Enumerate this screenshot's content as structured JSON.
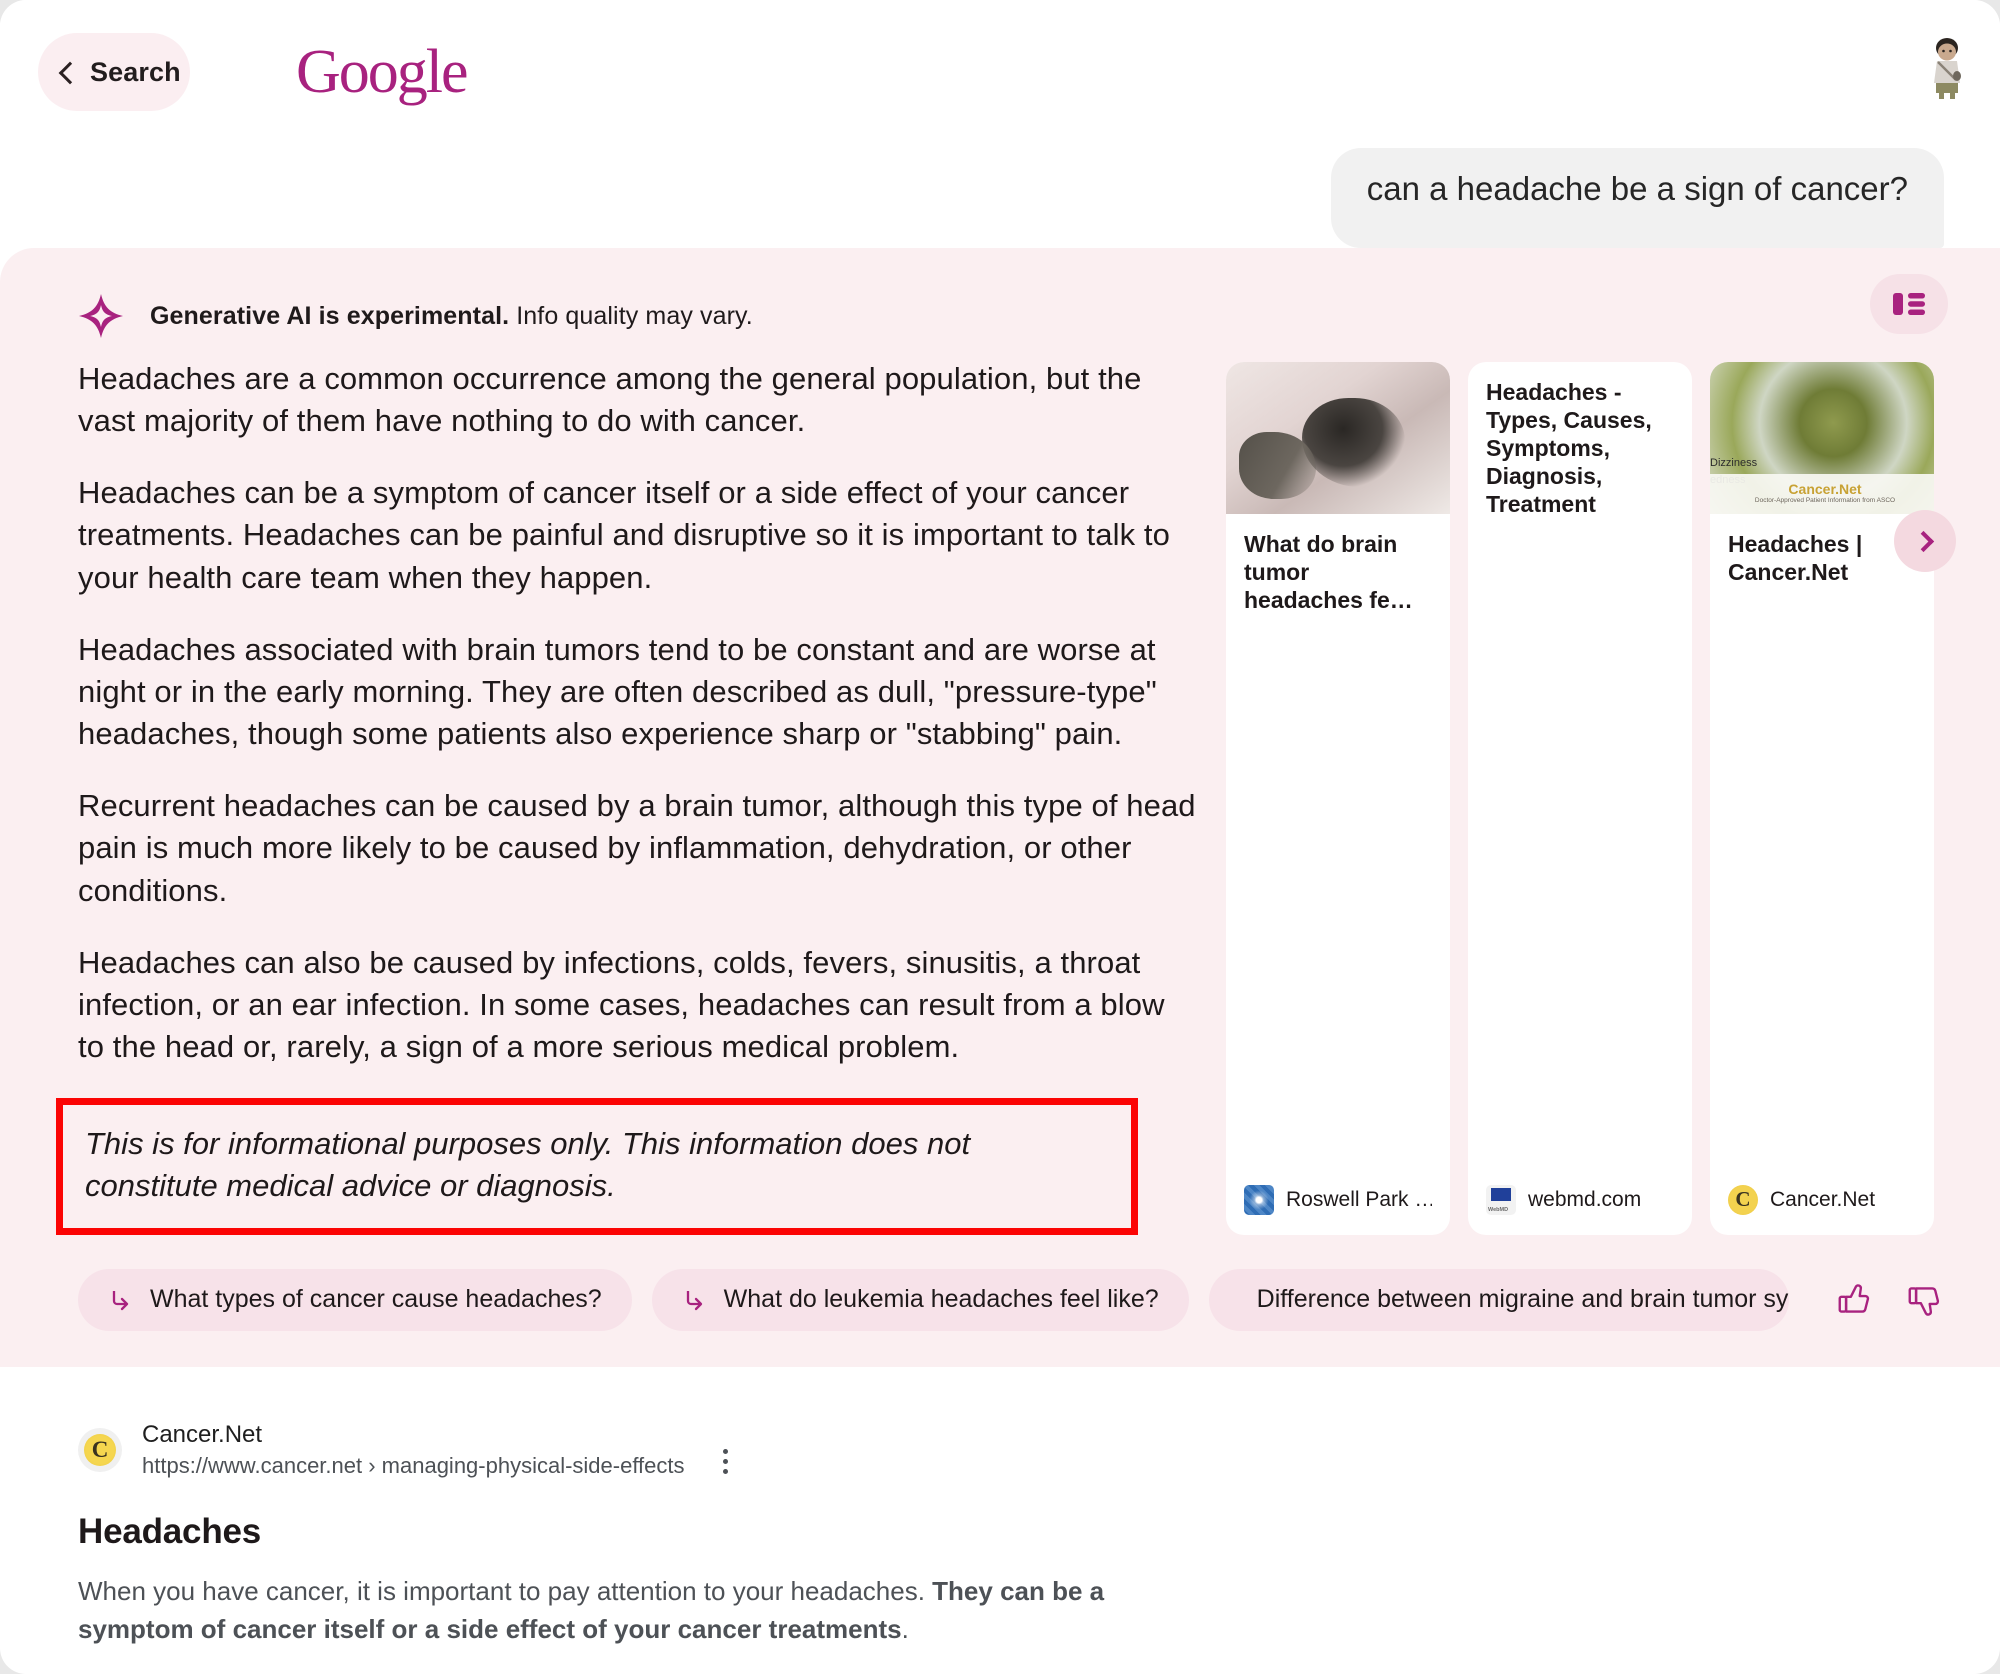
{
  "header": {
    "back_label": "Search",
    "logo_text": "Google",
    "avatar_name": "user-avatar"
  },
  "query": {
    "text": "can a headache be a sign of cancer?"
  },
  "ai_panel": {
    "notice_bold": "Generative AI is experimental.",
    "notice_light": " Info quality may vary.",
    "layout_toggle_name": "layout-view-toggle",
    "paragraphs": [
      "Headaches are a common occurrence among the general population, but the vast majority of them have nothing to do with cancer.",
      "Headaches can be a symptom of cancer itself or a side effect of your cancer treatments. Headaches can be painful and disruptive so it is important to talk to your health care team when they happen.",
      "Headaches associated with brain tumors tend to be constant and are worse at night or in the early morning. They are often described as dull, \"pressure-type\" headaches, though some patients also experience sharp or \"stabbing\" pain.",
      "Recurrent headaches can be caused by a brain tumor, although this type of head pain is much more likely to be caused by inflammation, dehydration, or other conditions.",
      "Headaches can also be caused by infections, colds, fevers, sinusitis, a throat infection, or an ear infection. In some cases, headaches can result from a blow to the head or, rarely, a sign of a more serious medical problem."
    ],
    "disclaimer": "This is for informational purposes only. This information does not constitute medical advice or diagnosis.",
    "disclaimer_highlight_color": "#fb0404",
    "cards": [
      {
        "title": "What do brain tumor headaches fe…",
        "source": "Roswell Park …",
        "has_image": true
      },
      {
        "title": "Headaches - Types, Causes, Symptoms, Diagnosis, Treatment",
        "source": "webmd.com",
        "has_image": false
      },
      {
        "title": "Headaches | Cancer.Net",
        "source": "Cancer.Net",
        "has_image": true,
        "image_overlay_title": "Cancer.Net",
        "image_overlay_subtitle": "Doctor-Approved Patient Information from ASCO",
        "image_side_words": "Dizziness\nedness"
      }
    ],
    "next_button_name": "cards-next-arrow",
    "chips": [
      "What types of cancer cause headaches?",
      "What do leukemia headaches feel like?",
      "Difference between migraine and brain tumor symptoms"
    ],
    "thumbs_up_name": "thumbs-up-icon",
    "thumbs_down_name": "thumbs-down-icon"
  },
  "result": {
    "favicon_letter": "C",
    "site": "Cancer.Net",
    "url": "https://www.cancer.net › managing-physical-side-effects",
    "title": "Headaches",
    "snippet_plain": "When you have cancer, it is important to pay attention to your headaches. ",
    "snippet_bold": "They can be a symptom of cancer itself or a side effect of your cancer treatments",
    "snippet_tail": "."
  },
  "colors": {
    "accent_magenta": "#a8227f",
    "ai_panel_bg": "#fbeff1",
    "chip_bg": "#f7e2e9",
    "query_bubble_bg": "#f1f1f1",
    "highlight_red": "#fb0404"
  }
}
